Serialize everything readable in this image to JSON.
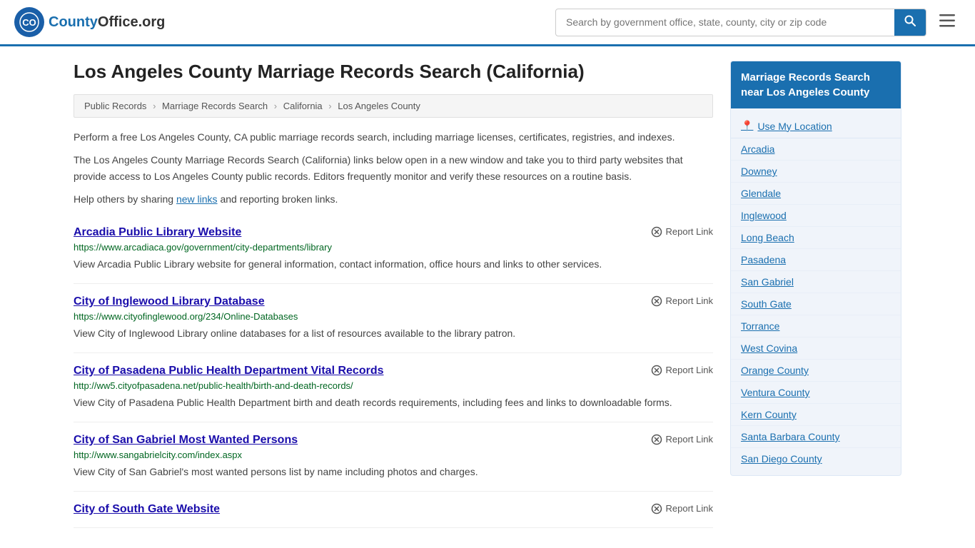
{
  "header": {
    "logo_text": "County",
    "logo_tld": "Office.org",
    "search_placeholder": "Search by government office, state, county, city or zip code",
    "search_value": ""
  },
  "page": {
    "title": "Los Angeles County Marriage Records Search (California)",
    "breadcrumbs": [
      {
        "label": "Public Records",
        "href": "#"
      },
      {
        "label": "Marriage Records Search",
        "href": "#"
      },
      {
        "label": "California",
        "href": "#"
      },
      {
        "label": "Los Angeles County",
        "href": "#"
      }
    ],
    "description1": "Perform a free Los Angeles County, CA public marriage records search, including marriage licenses, certificates, registries, and indexes.",
    "description2": "The Los Angeles County Marriage Records Search (California) links below open in a new window and take you to third party websites that provide access to Los Angeles County public records. Editors frequently monitor and verify these resources on a routine basis.",
    "description3_prefix": "Help others by sharing ",
    "description3_link": "new links",
    "description3_suffix": " and reporting broken links."
  },
  "results": [
    {
      "title": "Arcadia Public Library Website",
      "url": "https://www.arcadiaca.gov/government/city-departments/library",
      "description": "View Arcadia Public Library website for general information, contact information, office hours and links to other services.",
      "report_label": "Report Link"
    },
    {
      "title": "City of Inglewood Library Database",
      "url": "https://www.cityofinglewood.org/234/Online-Databases",
      "description": "View City of Inglewood Library online databases for a list of resources available to the library patron.",
      "report_label": "Report Link"
    },
    {
      "title": "City of Pasadena Public Health Department Vital Records",
      "url": "http://ww5.cityofpasadena.net/public-health/birth-and-death-records/",
      "description": "View City of Pasadena Public Health Department birth and death records requirements, including fees and links to downloadable forms.",
      "report_label": "Report Link"
    },
    {
      "title": "City of San Gabriel Most Wanted Persons",
      "url": "http://www.sangabrielcity.com/index.aspx",
      "description": "View City of San Gabriel's most wanted persons list by name including photos and charges.",
      "report_label": "Report Link"
    },
    {
      "title": "City of South Gate Website",
      "url": "",
      "description": "",
      "report_label": "Report Link"
    }
  ],
  "sidebar": {
    "title": "Marriage Records Search near Los Angeles County",
    "use_my_location": "Use My Location",
    "items": [
      "Arcadia",
      "Downey",
      "Glendale",
      "Inglewood",
      "Long Beach",
      "Pasadena",
      "San Gabriel",
      "South Gate",
      "Torrance",
      "West Covina",
      "Orange County",
      "Ventura County",
      "Kern County",
      "Santa Barbara County",
      "San Diego County"
    ]
  }
}
